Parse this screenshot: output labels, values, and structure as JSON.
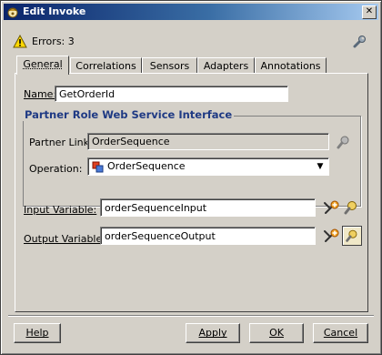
{
  "window": {
    "title": "Edit Invoke",
    "title_icon": "bpel-process-icon",
    "close_icon": "close-icon"
  },
  "status": {
    "errors_text": "Errors: 3",
    "warn_icon": "warning-triangle-icon",
    "wrench_icon": "wrench-icon"
  },
  "tabs": [
    {
      "label": "General",
      "active": true
    },
    {
      "label": "Correlations",
      "active": false
    },
    {
      "label": "Sensors",
      "active": false
    },
    {
      "label": "Adapters",
      "active": false
    },
    {
      "label": "Annotations",
      "active": false
    }
  ],
  "general": {
    "name_label": "Name:",
    "name_value": "GetOrderId",
    "partner_group_title": "Partner Role Web Service Interface",
    "partner_link_label": "Partner Link:",
    "partner_link_value": "OrderSequence",
    "operation_label": "Operation:",
    "operation_value": "OrderSequence",
    "input_variable_label": "Input Variable:",
    "input_variable_value": "orderSequenceInput",
    "output_variable_label": "Output Variable:",
    "output_variable_value": "orderSequenceOutput"
  },
  "buttons": {
    "help": "Help",
    "apply": "Apply",
    "ok": "OK",
    "cancel": "Cancel"
  },
  "colors": {
    "titlebar_start": "#0a246a",
    "titlebar_end": "#a6caf0",
    "group_title": "#1f3a84",
    "dialog_bg": "#d4d0c8"
  }
}
